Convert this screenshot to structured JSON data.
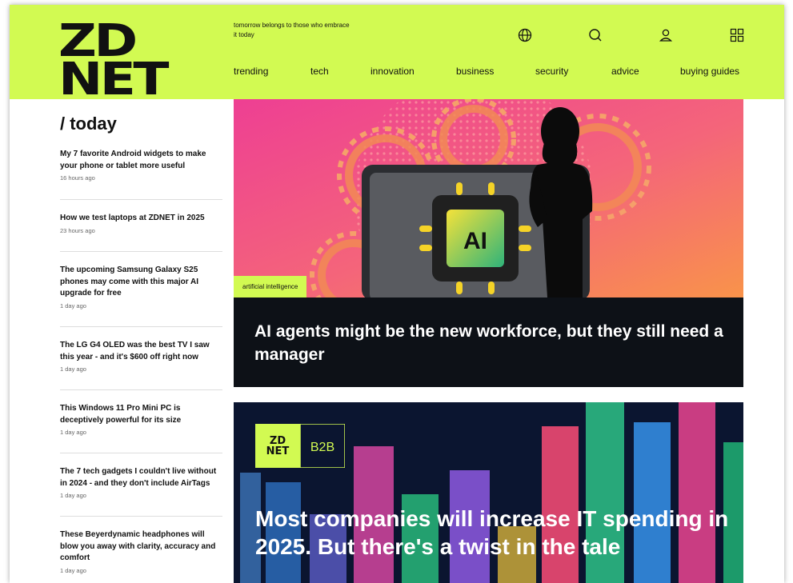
{
  "brand": {
    "logo_line1": "ZD",
    "logo_line2": "NET",
    "tagline": "tomorrow belongs to those who embrace it today"
  },
  "header_icons": [
    "globe-icon",
    "search-icon",
    "user-icon",
    "grid-menu-icon"
  ],
  "nav": [
    "trending",
    "tech",
    "innovation",
    "business",
    "security",
    "advice",
    "buying guides"
  ],
  "today": {
    "title": "/ today",
    "items": [
      {
        "title": "My 7 favorite Android widgets to make your phone or tablet more useful",
        "time": "16 hours ago"
      },
      {
        "title": "How we test laptops at ZDNET in 2025",
        "time": "23 hours ago"
      },
      {
        "title": "The upcoming Samsung Galaxy S25 phones may come with this major AI upgrade for free",
        "time": "1 day ago"
      },
      {
        "title": "The LG G4 OLED was the best TV I saw this year - and it's $600 off right now",
        "time": "1 day ago"
      },
      {
        "title": "This Windows 11 Pro Mini PC is deceptively powerful for its size",
        "time": "1 day ago"
      },
      {
        "title": "The 7 tech gadgets I couldn't live without in 2024 - and they don't include AirTags",
        "time": "1 day ago"
      },
      {
        "title": "These Beyerdynamic headphones will blow you away with clarity, accuracy and comfort",
        "time": "1 day ago"
      }
    ]
  },
  "hero": {
    "tag": "artificial intelligence",
    "chip_label": "AI",
    "headline": "AI agents might be the new workforce, but they still need a manager"
  },
  "feature2": {
    "badge_logo_line1": "ZD",
    "badge_logo_line2": "NET",
    "badge_label": "B2B",
    "headline": "Most companies will increase IT spending in 2025. But there's a twist in the tale"
  },
  "colors": {
    "accent": "#d2fa52",
    "dark": "#0d1117",
    "hero_pink": "#f0478f",
    "hero_orange": "#f8874a"
  }
}
